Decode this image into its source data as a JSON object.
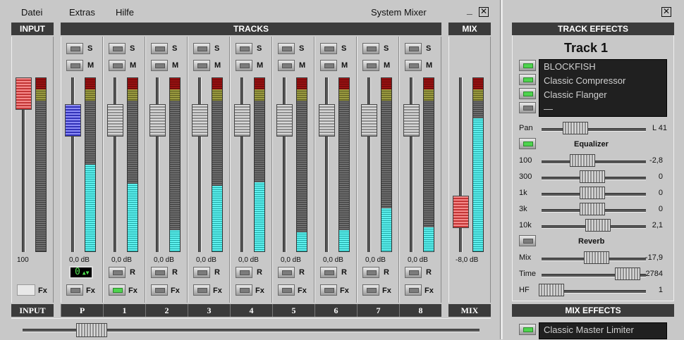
{
  "menu": {
    "file": "Datei",
    "extras": "Extras",
    "help": "Hilfe",
    "title": "System Mixer",
    "minimize": "_",
    "close": "☒"
  },
  "input": {
    "header": "INPUT",
    "footer": "INPUT",
    "level_label": "100",
    "fx_label": "Fx",
    "fader_level": 0.92,
    "meter_level": 0
  },
  "tracks": {
    "header": "TRACKS",
    "solo_label": "S",
    "mute_label": "M",
    "rec_label": "R",
    "fx_label": "Fx",
    "items": [
      {
        "name": "P",
        "db": "0,0 dB",
        "meter_level": 0.5,
        "fader": "blue",
        "fx_on": false
      },
      {
        "name": "1",
        "db": "0,0 dB",
        "meter_level": 0.39,
        "fader": "gray",
        "fx_on": true
      },
      {
        "name": "2",
        "db": "0,0 dB",
        "meter_level": 0.12,
        "fader": "gray",
        "fx_on": false
      },
      {
        "name": "3",
        "db": "0,0 dB",
        "meter_level": 0.38,
        "fader": "gray",
        "fx_on": false
      },
      {
        "name": "4",
        "db": "0,0 dB",
        "meter_level": 0.4,
        "fader": "gray",
        "fx_on": false
      },
      {
        "name": "5",
        "db": "0,0 dB",
        "meter_level": 0.11,
        "fader": "gray",
        "fx_on": false
      },
      {
        "name": "6",
        "db": "0,0 dB",
        "meter_level": 0.12,
        "fader": "gray",
        "fx_on": false
      },
      {
        "name": "7",
        "db": "0,0 dB",
        "meter_level": 0.25,
        "fader": "gray",
        "fx_on": false
      },
      {
        "name": "8",
        "db": "0,0 dB",
        "meter_level": 0.14,
        "fader": "gray",
        "fx_on": false
      }
    ],
    "p_display": "0"
  },
  "mix": {
    "header": "MIX",
    "footer": "MIX",
    "db": "-8,0 dB",
    "meter_level": 0.77
  },
  "track_effects": {
    "header": "TRACK EFFECTS",
    "close": "☒",
    "track_name": "Track 1",
    "fx_chain": [
      "BLOCKFISH",
      "Classic Compressor",
      "Classic Flanger",
      "—"
    ],
    "pan": {
      "label": "Pan",
      "value": "L 41"
    },
    "equalizer": {
      "title": "Equalizer",
      "bands": [
        {
          "label": "100",
          "value": "-2,8"
        },
        {
          "label": "300",
          "value": "0"
        },
        {
          "label": "1k",
          "value": "0"
        },
        {
          "label": "3k",
          "value": "0"
        },
        {
          "label": "10k",
          "value": "2,1"
        }
      ]
    },
    "reverb": {
      "title": "Reverb",
      "params": [
        {
          "label": "Mix",
          "value": "-17,9"
        },
        {
          "label": "Time",
          "value": "2784"
        },
        {
          "label": "HF",
          "value": "1"
        }
      ]
    }
  },
  "mix_effects": {
    "header": "MIX EFFECTS",
    "item": "Classic Master Limiter"
  }
}
